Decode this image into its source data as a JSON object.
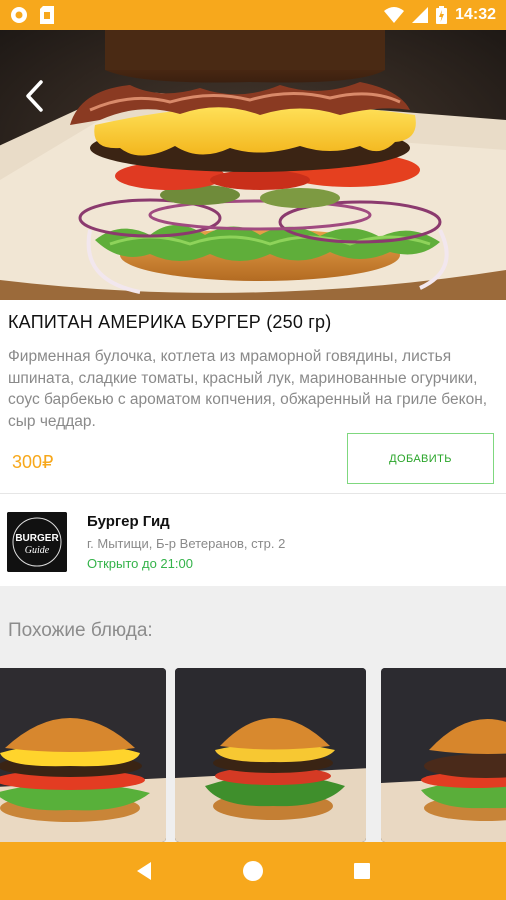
{
  "status_bar": {
    "time": "14:32",
    "left_icons": [
      "settings-circle-icon",
      "sim-card-icon"
    ],
    "right_icons": [
      "wifi-icon",
      "signal-icon",
      "battery-charging-icon"
    ],
    "color": "#f7a81c"
  },
  "hero": {
    "image": "burger-photo",
    "back_icon": "chevron-left-icon"
  },
  "dish": {
    "title": "КАПИТАН АМЕРИКА БУРГЕР (250 гр)",
    "description": "Фирменная булочка, котлета из мраморной говядины, листья шпината, сладкие томаты, красный лук, маринованные огурчики, соус барбекью с ароматом копчения, обжаренный на гриле бекон, сыр чеддар.",
    "price": "300₽",
    "add_button_label": "ДОБАВИТЬ",
    "price_color": "#f7a81c",
    "add_color": "#2aa52a"
  },
  "restaurant": {
    "name": "Бургер Гид",
    "address": "г. Мытищи, Б-р Ветеранов, стр. 2",
    "hours": "Открыто до 21:00",
    "logo_lines": [
      "BURGER",
      "Guide"
    ]
  },
  "similar": {
    "title": "Похожие блюда:",
    "items": [
      {
        "image": "burger-photo-1"
      },
      {
        "image": "burger-photo-2"
      },
      {
        "image": "burger-photo-3"
      }
    ]
  },
  "nav": {
    "icons": [
      "back-triangle-icon",
      "home-circle-icon",
      "recents-square-icon"
    ]
  }
}
